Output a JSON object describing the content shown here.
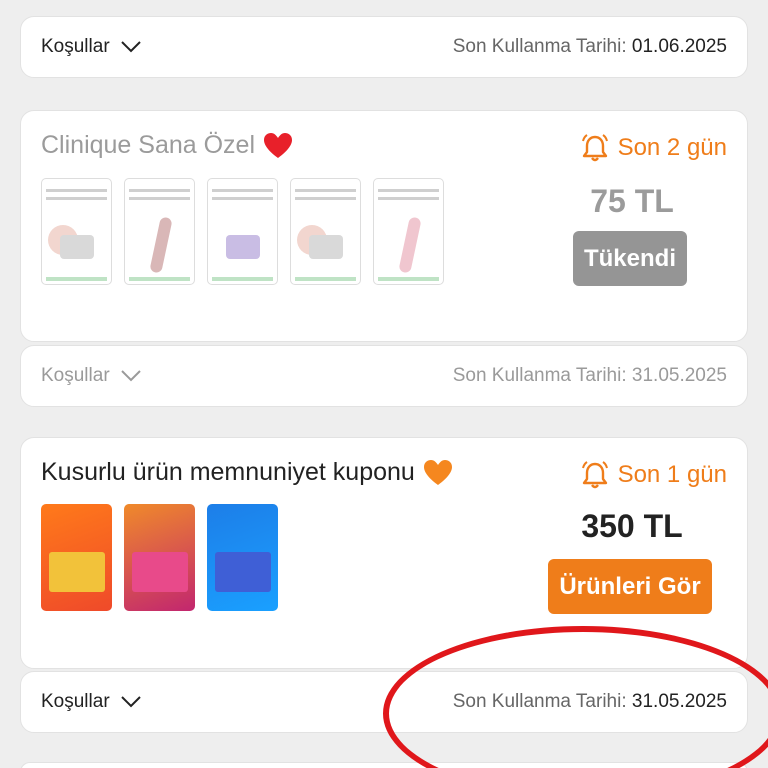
{
  "colors": {
    "accent": "#ef7d1a",
    "disabled": "#959595",
    "annotation": "#e0171b"
  },
  "top_terms": {
    "terms_label": "Koşullar",
    "expiry_label": "Son Kullanma Tarihi:",
    "expiry_date": "01.06.2025"
  },
  "coupons": [
    {
      "title": "Clinique Sana Özel",
      "title_icon": "red-heart-icon",
      "countdown": "Son 2 gün",
      "countdown_icon": "bell-icon",
      "amount": "75 TL",
      "button": "Tükendi",
      "status": "sold-out",
      "thumbnails": [
        "moisture-surge-cream",
        "lip-plumper-honey",
        "take-the-day-off-balm",
        "moisture-surge-cream",
        "pink-honey-lip"
      ],
      "terms_label": "Koşullar",
      "expiry_label": "Son Kullanma Tarihi:",
      "expiry_date": "31.05.2025"
    },
    {
      "title": "Kusurlu ürün memnuniyet kuponu",
      "title_icon": "orange-heart-icon",
      "countdown": "Son 1 gün",
      "countdown_icon": "bell-icon",
      "amount": "350 TL",
      "button": "Ürünleri Gör",
      "status": "active",
      "thumbnails": [
        "orange-gift-box",
        "pink-gift-box",
        "blue-gift-box"
      ],
      "terms_label": "Koşullar",
      "expiry_label": "Son Kullanma Tarihi:",
      "expiry_date": "31.05.2025"
    }
  ]
}
